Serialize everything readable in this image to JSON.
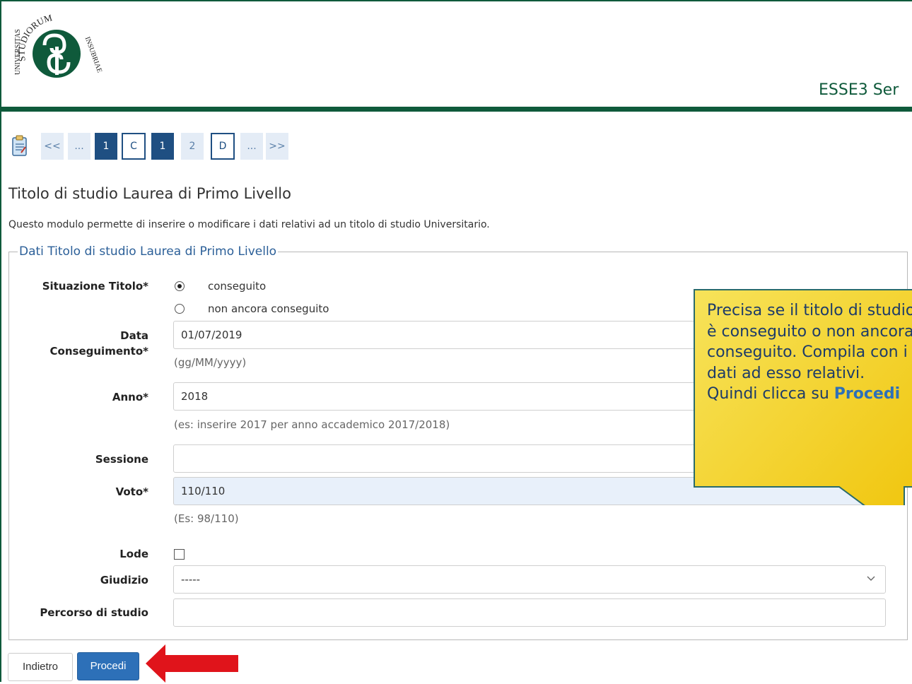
{
  "header": {
    "logo_text_top": "STUDIORUM",
    "logo_text_left": "UNIVERSITAS",
    "logo_text_right": "INSUBRIAE",
    "app_title": "ESSE3 Ser"
  },
  "steps": {
    "first": "<<",
    "dots_left": "...",
    "step_1a": "1",
    "step_c": "C",
    "step_1b": "1",
    "step_2": "2",
    "step_d": "D",
    "dots_right": "...",
    "last": ">>"
  },
  "page": {
    "title": "Titolo di studio Laurea di Primo Livello",
    "description": "Questo modulo permette di inserire o modificare i dati relativi ad un titolo di studio Universitario."
  },
  "form": {
    "legend": "Dati Titolo di studio Laurea di Primo Livello",
    "situazione_label": "Situazione Titolo*",
    "radio_conseguito": "conseguito",
    "radio_non_conseguito": "non ancora conseguito",
    "data_label_line1": "Data",
    "data_label_line2": "Conseguimento*",
    "data_value": "01/07/2019",
    "data_hint": "(gg/MM/yyyy)",
    "anno_label": "Anno*",
    "anno_value": "2018",
    "anno_hint": "(es: inserire 2017 per anno accademico 2017/2018)",
    "sessione_label": "Sessione",
    "sessione_value": "",
    "voto_label": "Voto*",
    "voto_value": "110/110",
    "voto_hint": "(Es: 98/110)",
    "lode_label": "Lode",
    "giudizio_label": "Giudizio",
    "giudizio_value": "-----",
    "percorso_label": "Percorso di studio",
    "percorso_value": ""
  },
  "buttons": {
    "back": "Indietro",
    "proceed": "Procedi"
  },
  "callout": {
    "text_before": "Precisa se il titolo di studio è conseguito o non ancora conseguito. Compila con i dati ad esso relativi. Quindi clicca su ",
    "keyword": "Procedi"
  },
  "colors": {
    "brand_green": "#0f5a3b",
    "primary_blue": "#2d70b8",
    "callout_yellow": "#f3d21a",
    "arrow_red": "#e0141b"
  }
}
